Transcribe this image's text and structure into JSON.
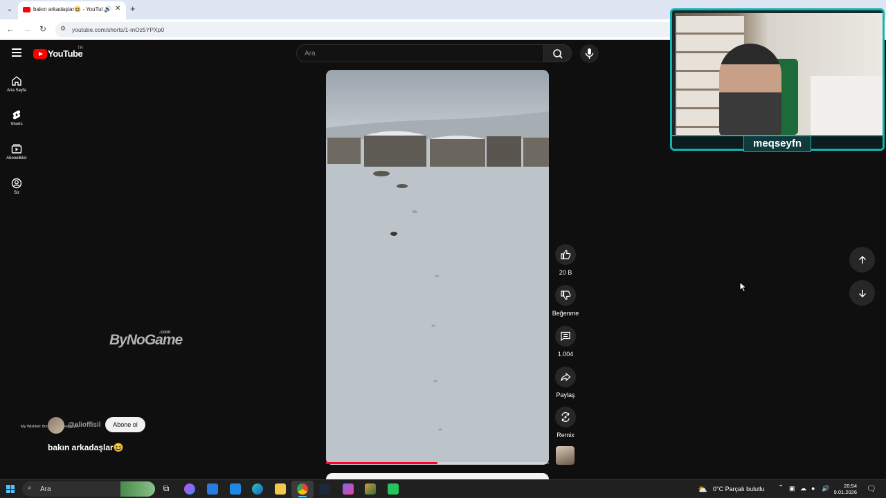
{
  "browser": {
    "tab": {
      "title": "bakın arkadaşlar😆 - YouTube"
    },
    "url": "youtube.com/shorts/1-mOz5YPXp0"
  },
  "youtube": {
    "logo_text": "YouTube",
    "country_code": "TR",
    "search_placeholder": "Ara",
    "sidebar": [
      {
        "label": "Ana Sayfa",
        "icon": "home-icon"
      },
      {
        "label": "Shorts",
        "icon": "shorts-icon"
      },
      {
        "label": "Abonelikler",
        "icon": "subscriptions-icon"
      },
      {
        "label": "Siz",
        "icon": "you-icon"
      }
    ],
    "watermark": {
      "text": "ByNoGame",
      "suffix": ".com"
    },
    "short": {
      "wishlist_text": "My Wishlist: throne.com/meqseyfn",
      "channel_handle": "@elioffisil",
      "subscribe_label": "Abone ol",
      "title": "bakın arkadaşlar😆",
      "progress_fraction": 0.5
    },
    "actions": {
      "like_count": "20 B",
      "dislike_label": "Beğenme",
      "comment_count": "1.004",
      "share_label": "Paylaş",
      "remix_label": "Remix"
    }
  },
  "overlay": {
    "streamer_name": "meqseyfn"
  },
  "taskbar": {
    "search_placeholder": "Ara",
    "weather": "0°C  Parçalı bulutlu",
    "time": "20:54",
    "date": "9.01.2026"
  },
  "colors": {
    "accent": "#ff0000",
    "progress": "#ff0033",
    "overlay_frame": "#10b4b0",
    "windows_accent": "#4cc2ff"
  }
}
